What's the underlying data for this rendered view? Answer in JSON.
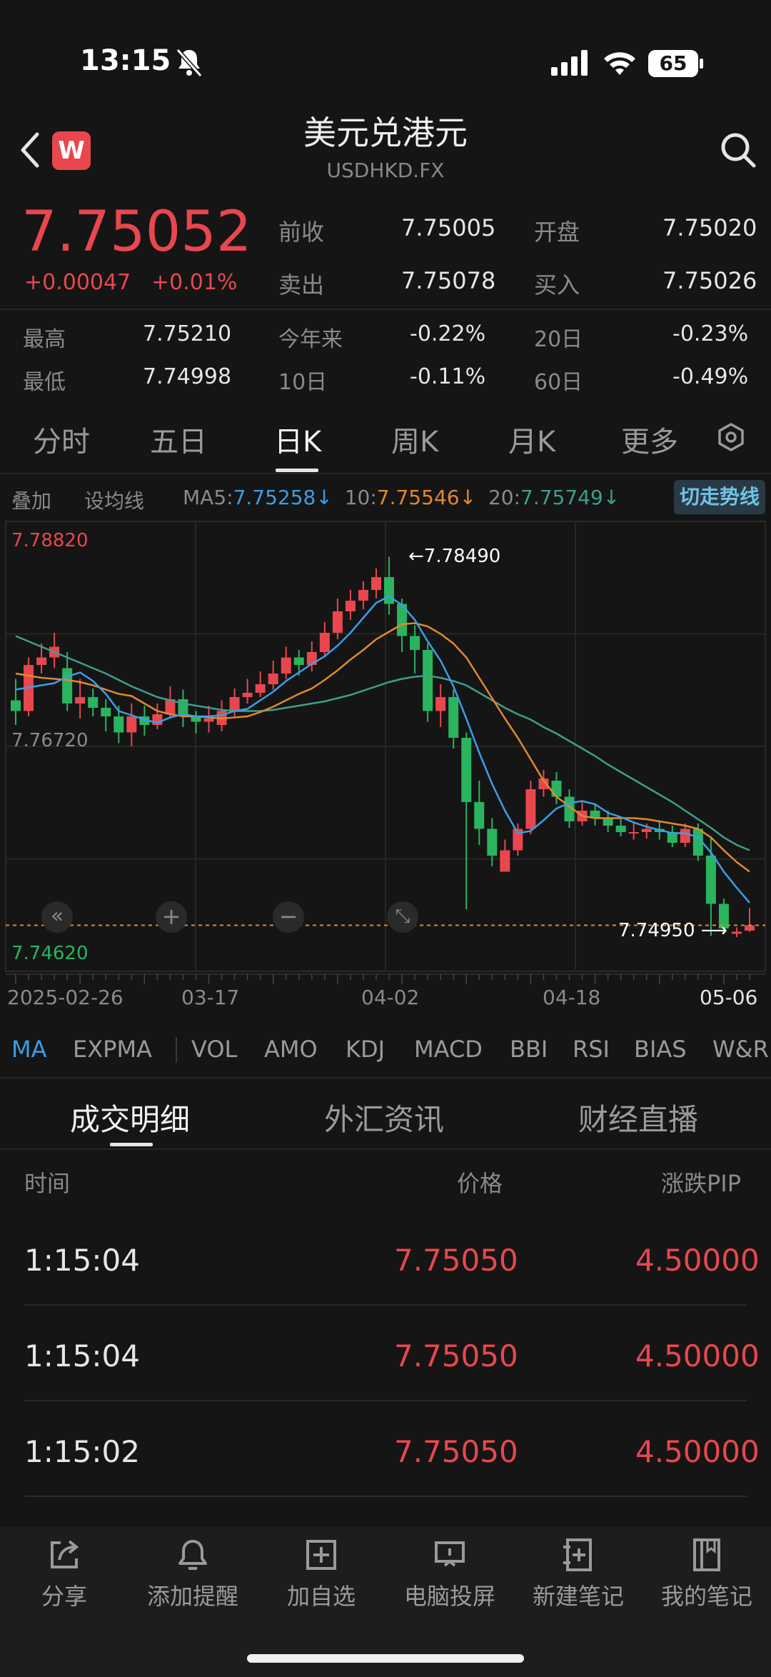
{
  "status_bar": {
    "time": "13:15",
    "battery": "65"
  },
  "header": {
    "title": "美元兑港元",
    "subtitle": "USDHKD.FX",
    "logo": "W"
  },
  "quote": {
    "price": "7.75052",
    "change": "+0.00047",
    "change_pct": "+0.01%",
    "prev_close_label": "前收",
    "prev_close": "7.75005",
    "open_label": "开盘",
    "open": "7.75020",
    "ask_label": "卖出",
    "ask": "7.75078",
    "bid_label": "买入",
    "bid": "7.75026",
    "high_label": "最高",
    "high": "7.75210",
    "low_label": "最低",
    "low": "7.74998",
    "ytd_label": "今年来",
    "ytd": "-0.22%",
    "d20_label": "20日",
    "d20": "-0.23%",
    "d10_label": "10日",
    "d10": "-0.11%",
    "d60_label": "60日",
    "d60": "-0.49%"
  },
  "period_tabs": [
    "分时",
    "五日",
    "日K",
    "周K",
    "月K",
    "更多"
  ],
  "active_period": "日K",
  "ma_bar": {
    "overlay": "叠加",
    "set_ma": "设均线",
    "ma5_label": "MA5:",
    "ma5": "7.75258↓",
    "ma10_label": "10:",
    "ma10": "7.75546↓",
    "ma20_label": "20:",
    "ma20": "7.75749↓",
    "switch": "切走势线"
  },
  "colors": {
    "up": "#e8474e",
    "down": "#2ab45e",
    "ma5": "#3b9ee8",
    "ma10": "#e0892e",
    "ma20": "#3f9e8c"
  },
  "chart_data": {
    "type": "candlestick",
    "y_top_label": "7.78820",
    "y_mid_label": "7.76720",
    "y_bottom_label": "7.74620",
    "ylim": [
      7.7462,
      7.7882
    ],
    "x_labels": [
      "2025-02-26",
      "03-17",
      "04-02",
      "04-18",
      "05-06"
    ],
    "annotation_high": "7.78490",
    "annotation_last": "7.74950",
    "candles": [
      [
        7.7715,
        7.7705,
        7.7735,
        7.7692
      ],
      [
        7.7705,
        7.7748,
        7.7755,
        7.77
      ],
      [
        7.7748,
        7.7755,
        7.7768,
        7.774
      ],
      [
        7.7755,
        7.7765,
        7.7778,
        7.7745
      ],
      [
        7.7745,
        7.7712,
        7.776,
        7.7705
      ],
      [
        7.7712,
        7.7718,
        7.7735,
        7.7698
      ],
      [
        7.7718,
        7.7708,
        7.7726,
        7.77
      ],
      [
        7.7708,
        7.77,
        7.7716,
        7.7686
      ],
      [
        7.77,
        7.7685,
        7.771,
        7.7675
      ],
      [
        7.7685,
        7.77,
        7.7712,
        7.7672
      ],
      [
        7.77,
        7.7692,
        7.771,
        7.7682
      ],
      [
        7.7692,
        7.7702,
        7.7712,
        7.7688
      ],
      [
        7.7702,
        7.7716,
        7.7728,
        7.7698
      ],
      [
        7.7716,
        7.77,
        7.7725,
        7.769
      ],
      [
        7.77,
        7.7695,
        7.7705,
        7.7684
      ],
      [
        7.7695,
        7.7698,
        7.771,
        7.7685
      ],
      [
        7.7692,
        7.7705,
        7.7715,
        7.7686
      ],
      [
        7.7705,
        7.7718,
        7.7726,
        7.77
      ],
      [
        7.7718,
        7.7722,
        7.7735,
        7.7712
      ],
      [
        7.7722,
        7.773,
        7.7742,
        7.7718
      ],
      [
        7.773,
        7.774,
        7.7752,
        7.7725
      ],
      [
        7.774,
        7.7755,
        7.7765,
        7.7735
      ],
      [
        7.7755,
        7.7748,
        7.7762,
        7.7738
      ],
      [
        7.7748,
        7.776,
        7.777,
        7.7742
      ],
      [
        7.776,
        7.7778,
        7.7788,
        7.7755
      ],
      [
        7.7778,
        7.7798,
        7.781,
        7.7772
      ],
      [
        7.7798,
        7.7808,
        7.7818,
        7.779
      ],
      [
        7.7808,
        7.7818,
        7.7826,
        7.78
      ],
      [
        7.7818,
        7.783,
        7.7838,
        7.781
      ],
      [
        7.783,
        7.7805,
        7.7849,
        7.7795
      ],
      [
        7.7805,
        7.7775,
        7.781,
        7.776
      ],
      [
        7.7775,
        7.7762,
        7.7785,
        7.774
      ],
      [
        7.7762,
        7.7705,
        7.7768,
        7.7695
      ],
      [
        7.7705,
        7.7718,
        7.773,
        7.769
      ],
      [
        7.7718,
        7.768,
        7.7725,
        7.767
      ],
      [
        7.768,
        7.762,
        7.7685,
        7.752
      ],
      [
        7.762,
        7.7595,
        7.764,
        7.758
      ],
      [
        7.7595,
        7.757,
        7.7605,
        7.756
      ],
      [
        7.7555,
        7.7575,
        7.7585,
        7.7555
      ],
      [
        7.7575,
        7.7595,
        7.76,
        7.757
      ],
      [
        7.7595,
        7.7632,
        7.764,
        7.759
      ],
      [
        7.7632,
        7.7642,
        7.765,
        7.7625
      ],
      [
        7.764,
        7.7625,
        7.7648,
        7.7618
      ],
      [
        7.7625,
        7.7602,
        7.7632,
        7.7596
      ],
      [
        7.7602,
        7.7612,
        7.762,
        7.7598
      ],
      [
        7.7612,
        7.7605,
        7.7618,
        7.7598
      ],
      [
        7.7605,
        7.7598,
        7.7612,
        7.7592
      ],
      [
        7.7598,
        7.7592,
        7.7605,
        7.7588
      ],
      [
        7.7592,
        7.7592,
        7.7602,
        7.7585
      ],
      [
        7.7592,
        7.7595,
        7.76,
        7.7586
      ],
      [
        7.7595,
        7.7592,
        7.7603,
        7.7585
      ],
      [
        7.7592,
        7.7582,
        7.7598,
        7.7578
      ],
      [
        7.7582,
        7.7595,
        7.76,
        7.7578
      ],
      [
        7.7595,
        7.757,
        7.76,
        7.7565
      ],
      [
        7.757,
        7.7525,
        7.7588,
        7.7495
      ],
      [
        7.7525,
        7.7502,
        7.753,
        7.7497
      ],
      [
        7.7497,
        7.7499,
        7.7503,
        7.7494
      ],
      [
        7.75,
        7.7505,
        7.7521,
        7.7499
      ]
    ],
    "ma5": [
      7.7725,
      7.7727,
      7.7729,
      7.7731,
      7.7737,
      7.7741,
      7.7733,
      7.7721,
      7.7705,
      7.7701,
      7.7697,
      7.7694,
      7.7699,
      7.7702,
      7.77,
      7.77,
      7.7701,
      7.7705,
      7.7707,
      7.7715,
      7.7723,
      7.7733,
      7.7741,
      7.7749,
      7.7756,
      7.7766,
      7.7778,
      7.7792,
      7.7806,
      7.7812,
      7.7804,
      7.779,
      7.777,
      7.7752,
      7.7728,
      7.7698,
      7.7666,
      7.7637,
      7.7612,
      7.7591,
      7.7593,
      7.7603,
      7.7614,
      7.7619,
      7.7621,
      7.7618,
      7.761,
      7.7606,
      7.7601,
      7.7597,
      7.7594,
      7.7591,
      7.7591,
      7.7587,
      7.7573,
      7.7555,
      7.754,
      7.7526
    ],
    "ma10": [
      7.774,
      7.7738,
      7.7736,
      7.7735,
      7.7734,
      7.7732,
      7.7729,
      7.7725,
      7.7721,
      7.7719,
      7.7712,
      7.7705,
      7.7702,
      7.77,
      7.77,
      7.7699,
      7.7698,
      7.7699,
      7.77,
      7.7704,
      7.7709,
      7.7715,
      7.7721,
      7.7726,
      7.7734,
      7.7743,
      7.7753,
      7.7762,
      7.7772,
      7.7779,
      7.7786,
      7.7787,
      7.7784,
      7.7777,
      7.7768,
      7.7755,
      7.7736,
      7.7717,
      7.7698,
      7.768,
      7.766,
      7.764,
      7.7625,
      7.7616,
      7.7607,
      7.7605,
      7.7605,
      7.7605,
      7.7605,
      7.7604,
      7.7602,
      7.76,
      7.7598,
      7.7595,
      7.7587,
      7.7575,
      7.7564,
      7.7555
    ],
    "ma20": [
      7.7775,
      7.777,
      7.7765,
      7.776,
      7.7755,
      7.775,
      7.7745,
      7.774,
      7.7734,
      7.7728,
      7.7723,
      7.7718,
      7.7715,
      7.7712,
      7.771,
      7.7708,
      7.7706,
      7.7705,
      7.7705,
      7.7705,
      7.7706,
      7.7708,
      7.771,
      7.7712,
      7.7714,
      7.7717,
      7.772,
      7.7724,
      7.7728,
      7.7732,
      7.7735,
      7.7737,
      7.7738,
      7.7736,
      7.7733,
      7.7729,
      7.7722,
      7.7715,
      7.7708,
      7.7702,
      7.7697,
      7.769,
      7.7684,
      7.7677,
      7.767,
      7.7663,
      7.7655,
      7.7648,
      7.7641,
      7.7634,
      7.7627,
      7.762,
      7.7612,
      7.7604,
      7.7596,
      7.7587,
      7.758,
      7.7575
    ]
  },
  "indicator_tabs": [
    "MA",
    "EXPMA",
    "VOL",
    "AMO",
    "KDJ",
    "MACD",
    "BBI",
    "RSI",
    "BIAS",
    "W&R"
  ],
  "bottom_tabs": [
    "成交明细",
    "外汇资讯",
    "财经直播"
  ],
  "trade_table": {
    "headers": [
      "时间",
      "价格",
      "涨跌PIP"
    ],
    "rows": [
      {
        "time": "1:15:04",
        "price": "7.75050",
        "pip": "4.50000"
      },
      {
        "time": "1:15:04",
        "price": "7.75050",
        "pip": "4.50000"
      },
      {
        "time": "1:15:02",
        "price": "7.75050",
        "pip": "4.50000"
      }
    ]
  },
  "toolbar": [
    {
      "label": "分享",
      "icon": "share-icon"
    },
    {
      "label": "添加提醒",
      "icon": "bell-icon"
    },
    {
      "label": "加自选",
      "icon": "add-watchlist-icon"
    },
    {
      "label": "电脑投屏",
      "icon": "cast-screen-icon"
    },
    {
      "label": "新建笔记",
      "icon": "new-note-icon"
    },
    {
      "label": "我的笔记",
      "icon": "notebook-icon"
    }
  ]
}
